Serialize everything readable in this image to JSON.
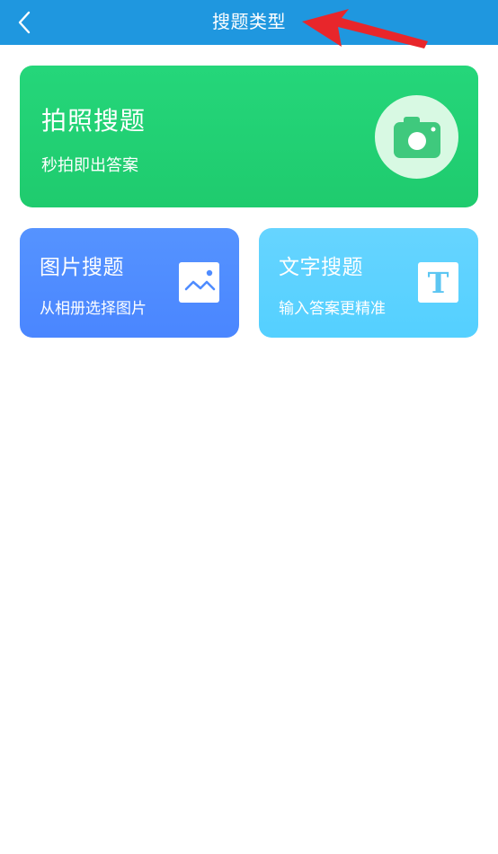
{
  "header": {
    "title": "搜题类型",
    "back_icon": "chevron-left-icon"
  },
  "cards": {
    "photo": {
      "title": "拍照搜题",
      "subtitle": "秒拍即出答案",
      "icon": "camera-icon"
    },
    "image": {
      "title": "图片搜题",
      "subtitle": "从相册选择图片",
      "icon": "image-icon"
    },
    "text": {
      "title": "文字搜题",
      "subtitle": "输入答案更精准",
      "icon": "text-t-icon",
      "icon_glyph": "T"
    }
  },
  "colors": {
    "header_bg": "#1f97df",
    "photo_card": "#22d172",
    "image_card": "#4f8cff",
    "text_card": "#5cd2ff",
    "annotation": "#e8262b"
  }
}
